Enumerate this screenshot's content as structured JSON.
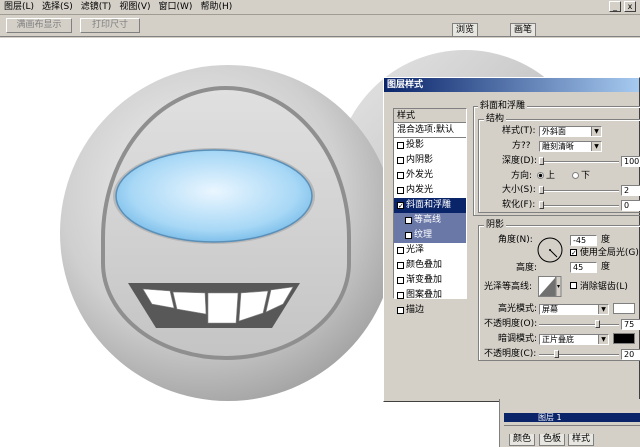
{
  "menu": [
    "图层(L)",
    "选择(S)",
    "滤镜(T)",
    "视图(V)",
    "窗口(W)",
    "帮助(H)"
  ],
  "window_controls": [
    "_",
    "x"
  ],
  "options": {
    "fit_screen": "满画布显示",
    "print_size": "打印尺寸"
  },
  "panel_tabs": [
    "浏览",
    "画笔"
  ],
  "dialog": {
    "title": "图层样式",
    "styles_header": "样式",
    "blend_options": "混合选项:默认",
    "styles": [
      {
        "label": "投影",
        "checked": false,
        "sub": false,
        "selected": false
      },
      {
        "label": "内阴影",
        "checked": false,
        "sub": false,
        "selected": false
      },
      {
        "label": "外发光",
        "checked": false,
        "sub": false,
        "selected": false
      },
      {
        "label": "内发光",
        "checked": false,
        "sub": false,
        "selected": false
      },
      {
        "label": "斜面和浮雕",
        "checked": true,
        "sub": false,
        "selected": true
      },
      {
        "label": "等高线",
        "checked": false,
        "sub": true,
        "selected": false
      },
      {
        "label": "纹理",
        "checked": false,
        "sub": true,
        "selected": false
      },
      {
        "label": "光泽",
        "checked": false,
        "sub": false,
        "selected": false
      },
      {
        "label": "颜色叠加",
        "checked": false,
        "sub": false,
        "selected": false
      },
      {
        "label": "渐变叠加",
        "checked": false,
        "sub": false,
        "selected": false
      },
      {
        "label": "图案叠加",
        "checked": false,
        "sub": false,
        "selected": false
      },
      {
        "label": "描边",
        "checked": false,
        "sub": false,
        "selected": false
      }
    ],
    "bevel": {
      "section_title": "斜面和浮雕",
      "structure_title": "结构",
      "style_label": "样式(T):",
      "style_value": "外斜面",
      "technique_label": "方??",
      "technique_value": "雕刻清晰",
      "depth_label": "深度(D):",
      "depth_value": "100",
      "direction_label": "方向:",
      "dir_up": "上",
      "dir_down": "下",
      "size_label": "大小(S):",
      "size_value": "2",
      "soften_label": "软化(F):",
      "soften_value": "0"
    },
    "shading": {
      "title": "阴影",
      "angle_label": "角度(N):",
      "angle_value": "-45",
      "angle_unit": "度",
      "global_light": "使用全局光(G)",
      "altitude_label": "高度:",
      "altitude_value": "45",
      "altitude_unit": "度",
      "gloss_label": "光泽等高线:",
      "antialias": "消除锯齿(L)",
      "highlight_label": "高光模式:",
      "highlight_value": "屏幕",
      "highlight_color": "#ffffff",
      "opacity1_label": "不透明度(O):",
      "opacity1_value": "75",
      "shadow_label": "暗调模式:",
      "shadow_value": "正片叠底",
      "shadow_color": "#000000",
      "opacity2_label": "不透明度(C):",
      "opacity2_value": "20"
    }
  },
  "bottom_tabs": [
    "颜色",
    "色板",
    "样式"
  ],
  "layer_name": "图层 1"
}
